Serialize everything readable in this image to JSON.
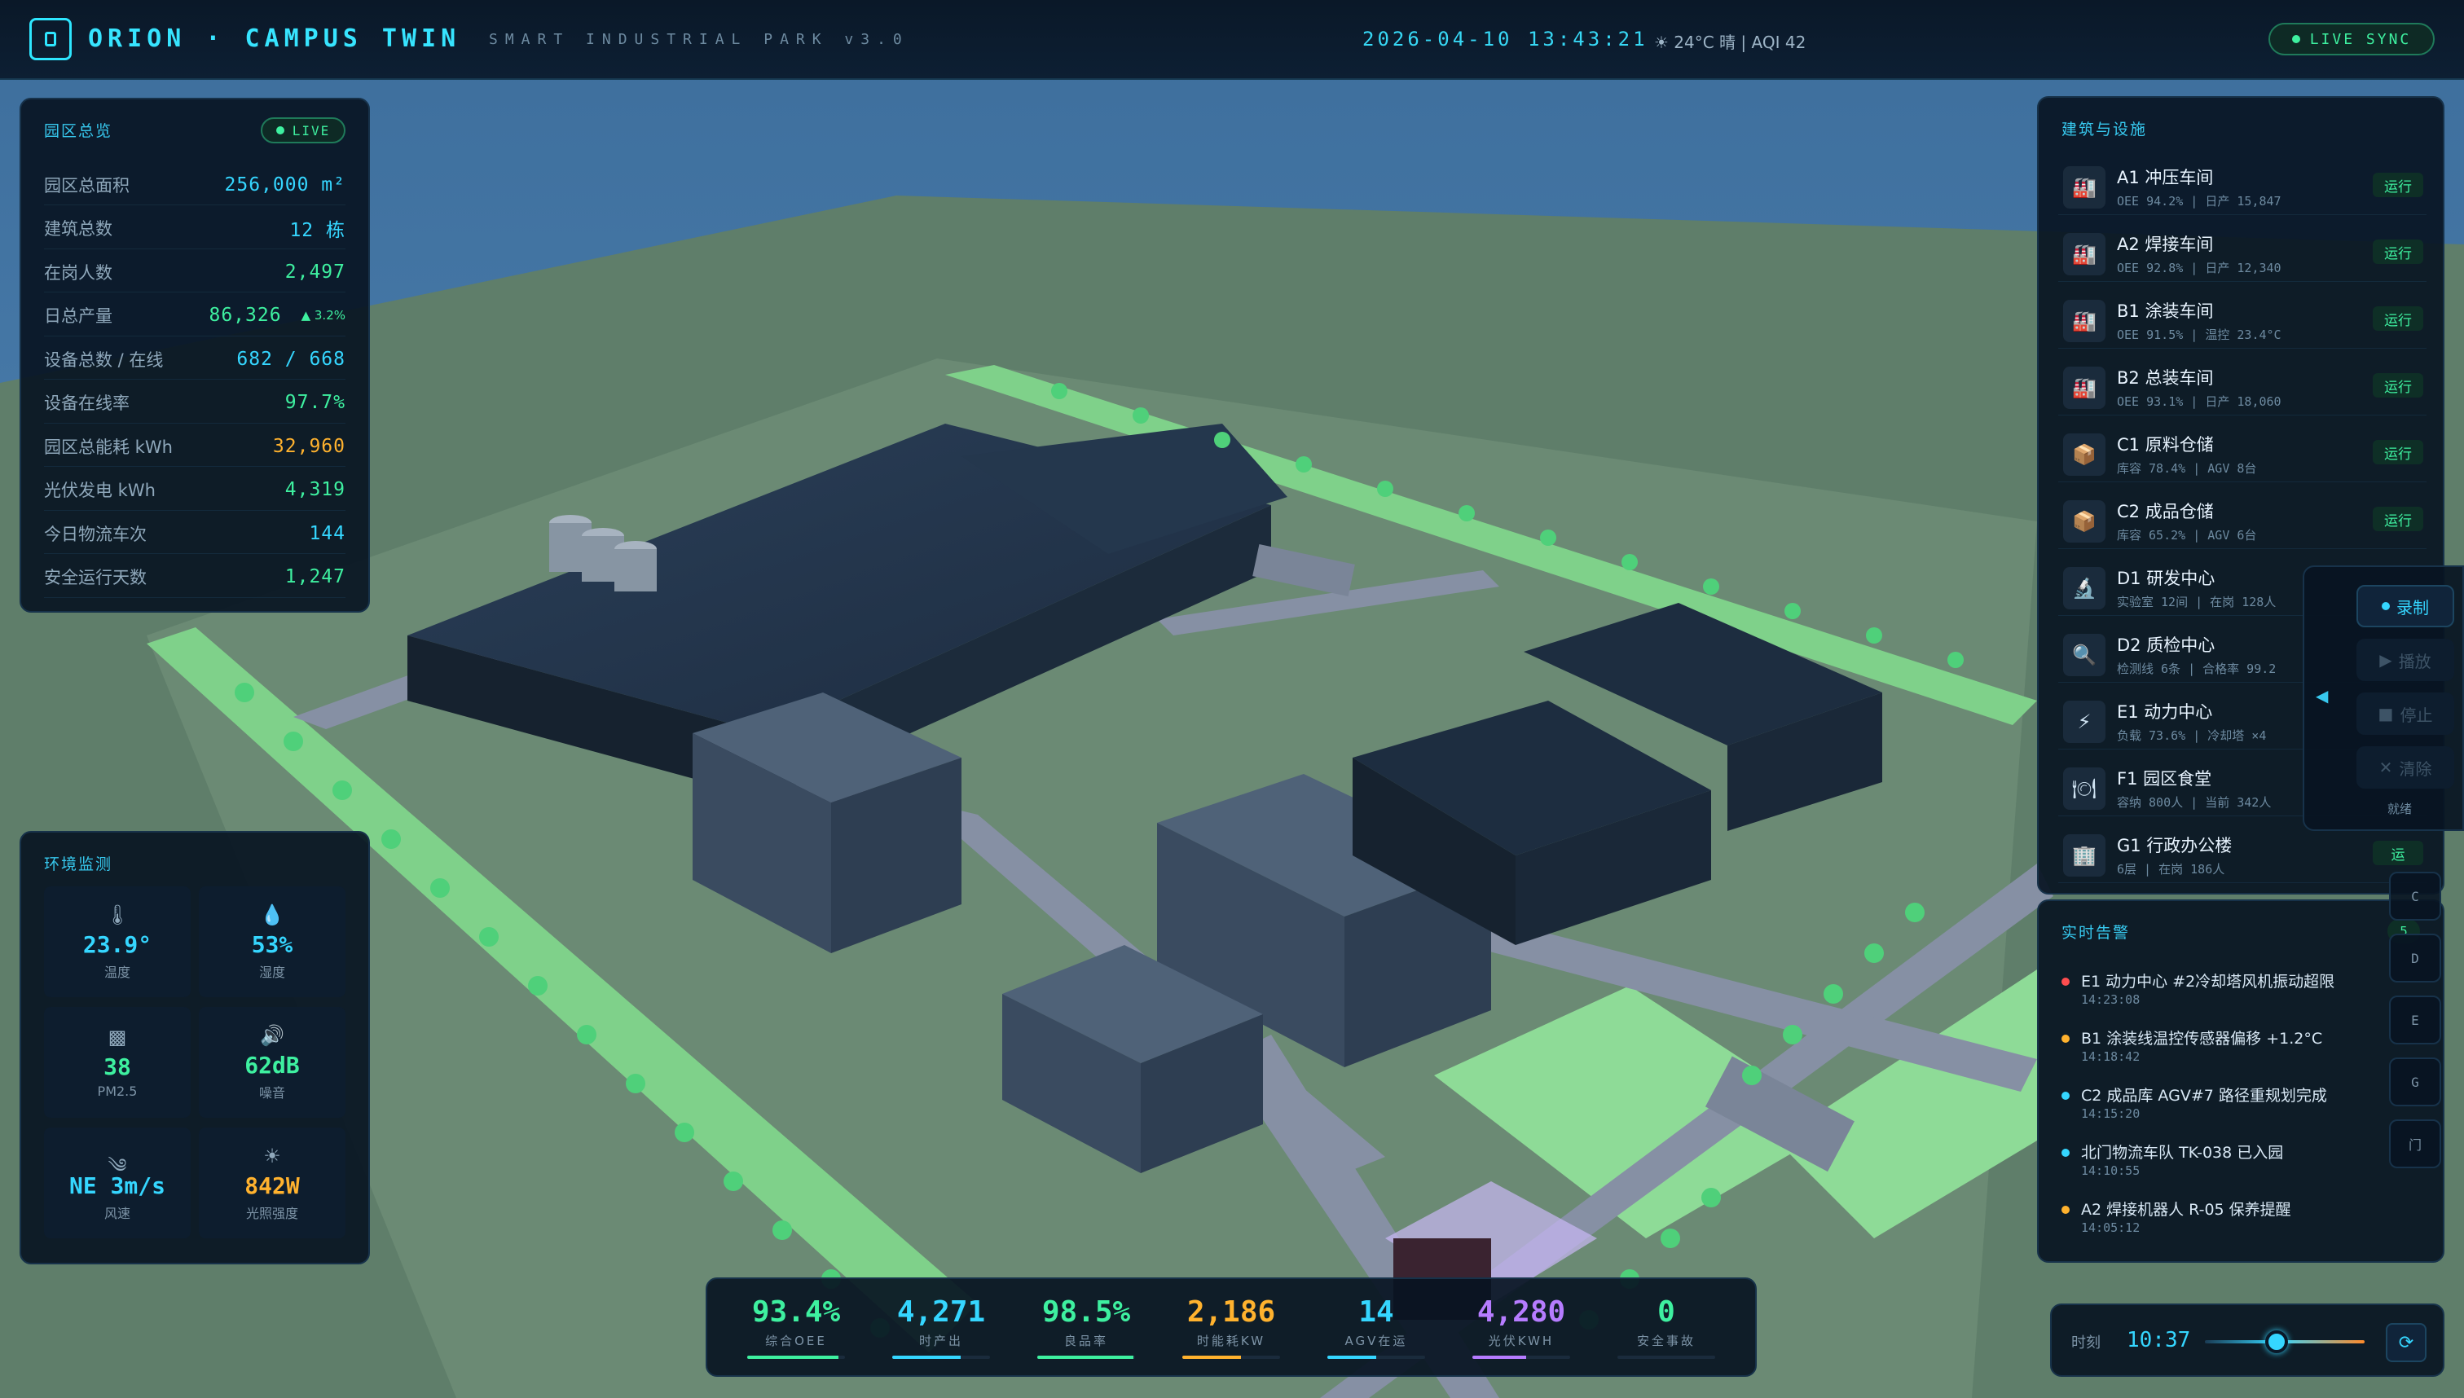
{
  "header": {
    "brand": "ORION · CAMPUS TWIN",
    "subtitle": "SMART INDUSTRIAL PARK v3.0",
    "datetime": "2026-04-10  13:43:21",
    "weather": "☀ 24°C 晴 | AQI 42",
    "live_sync": "LIVE SYNC"
  },
  "overview": {
    "title": "园区总览",
    "live": "LIVE",
    "rows": [
      {
        "label": "园区总面积",
        "value": "256,000 m²",
        "color": "cyan"
      },
      {
        "label": "建筑总数",
        "value": "12 栋",
        "color": "cyan"
      },
      {
        "label": "在岗人数",
        "value": "2,497",
        "color": "green"
      },
      {
        "label": "日总产量",
        "value": "86,326",
        "color": "green",
        "trend": "▲ 3.2%"
      },
      {
        "label": "设备总数 / 在线",
        "value": "682 / 668",
        "color": "cyan"
      },
      {
        "label": "设备在线率",
        "value": "97.7%",
        "color": "green"
      },
      {
        "label": "园区总能耗 kWh",
        "value": "32,960",
        "color": "orange"
      },
      {
        "label": "光伏发电 kWh",
        "value": "4,319",
        "color": "green"
      },
      {
        "label": "今日物流车次",
        "value": "144",
        "color": "cyan"
      },
      {
        "label": "安全运行天数",
        "value": "1,247",
        "color": "green"
      }
    ]
  },
  "environment": {
    "title": "环境监测",
    "cells": [
      {
        "icon": "thermometer-icon",
        "glyph": "🌡",
        "value": "23.9°",
        "label": "温度",
        "color": "cyan"
      },
      {
        "icon": "humidity-icon",
        "glyph": "💧",
        "value": "53%",
        "label": "湿度",
        "color": "cyan"
      },
      {
        "icon": "pm25-icon",
        "glyph": "▩",
        "value": "38",
        "label": "PM2.5",
        "color": "green"
      },
      {
        "icon": "noise-icon",
        "glyph": "🔊",
        "value": "62dB",
        "label": "噪音",
        "color": "green"
      },
      {
        "icon": "wind-icon",
        "glyph": "༄",
        "value": "NE 3m/s",
        "label": "风速",
        "color": "cyan"
      },
      {
        "icon": "sun-icon",
        "glyph": "☀",
        "value": "842W",
        "label": "光照强度",
        "color": "orange"
      }
    ]
  },
  "buildings": {
    "title": "建筑与设施",
    "items": [
      {
        "icon": "factory-icon",
        "glyph": "🏭",
        "name": "A1 冲压车间",
        "sub": "OEE 94.2% | 日产 15,847",
        "status": "运行"
      },
      {
        "icon": "factory-icon",
        "glyph": "🏭",
        "name": "A2 焊接车间",
        "sub": "OEE 92.8% | 日产 12,340",
        "status": "运行"
      },
      {
        "icon": "factory-icon",
        "glyph": "🏭",
        "name": "B1 涂装车间",
        "sub": "OEE 91.5% | 温控 23.4°C",
        "status": "运行"
      },
      {
        "icon": "factory-icon",
        "glyph": "🏭",
        "name": "B2 总装车间",
        "sub": "OEE 93.1% | 日产 18,060",
        "status": "运行"
      },
      {
        "icon": "warehouse-icon",
        "glyph": "📦",
        "name": "C1 原料仓储",
        "sub": "库容 78.4% | AGV 8台",
        "status": "运行"
      },
      {
        "icon": "warehouse-icon",
        "glyph": "📦",
        "name": "C2 成品仓储",
        "sub": "库容 65.2% | AGV 6台",
        "status": "运行"
      },
      {
        "icon": "microscope-icon",
        "glyph": "🔬",
        "name": "D1 研发中心",
        "sub": "实验室 12间 | 在岗 128人",
        "status": ""
      },
      {
        "icon": "magnifier-icon",
        "glyph": "🔍",
        "name": "D2 质检中心",
        "sub": "检测线 6条 | 合格率 99.2",
        "status": ""
      },
      {
        "icon": "lightning-icon",
        "glyph": "⚡",
        "name": "E1 动力中心",
        "sub": "负载 73.6% | 冷却塔 ×4",
        "status": ""
      },
      {
        "icon": "dining-icon",
        "glyph": "🍽",
        "name": "F1 园区食堂",
        "sub": "容纳 800人 | 当前 342人",
        "status": ""
      },
      {
        "icon": "office-icon",
        "glyph": "🏢",
        "name": "G1 行政办公楼",
        "sub": "6层 | 在岗 186人",
        "status": "运"
      }
    ]
  },
  "alerts": {
    "title": "实时告警",
    "count": "5",
    "items": [
      {
        "level": "#ff4d4f",
        "text": "E1 动力中心 #2冷却塔风机振动超限",
        "time": "14:23:08"
      },
      {
        "level": "#ffb22e",
        "text": "B1 涂装线温控传感器偏移 +1.2°C",
        "time": "14:18:42"
      },
      {
        "level": "#35d6ff",
        "text": "C2 成品库 AGV#7 路径重规划完成",
        "time": "14:15:20"
      },
      {
        "level": "#35d6ff",
        "text": "北门物流车队 TK-038 已入园",
        "time": "14:10:55"
      },
      {
        "level": "#ffb22e",
        "text": "A2 焊接机器人 R-05 保养提醒",
        "time": "14:05:12"
      }
    ]
  },
  "recorder": {
    "record": "录制",
    "play": "播放",
    "stop": "停止",
    "clear": "清除",
    "status": "就绪"
  },
  "floor_tabs": [
    "C",
    "D",
    "E",
    "G",
    "门"
  ],
  "kpis": [
    {
      "value": "93.4%",
      "label": "综合OEE",
      "color": "#3ef0a0",
      "fill": 0.93
    },
    {
      "value": "4,271",
      "label": "时产出",
      "color": "#35d6ff",
      "fill": 0.7
    },
    {
      "value": "98.5%",
      "label": "良品率",
      "color": "#3ef0a0",
      "fill": 0.98
    },
    {
      "value": "2,186",
      "label": "时能耗KW",
      "color": "#ffb22e",
      "fill": 0.6
    },
    {
      "value": "14",
      "label": "AGV在运",
      "color": "#35d6ff",
      "fill": 0.5
    },
    {
      "value": "4,280",
      "label": "光伏KWH",
      "color": "#b67cff",
      "fill": 0.55
    },
    {
      "value": "0",
      "label": "安全事故",
      "color": "#3ef0a0",
      "fill": 0
    }
  ],
  "timeline": {
    "label": "时刻",
    "value": "10:37",
    "position": 0.45
  }
}
